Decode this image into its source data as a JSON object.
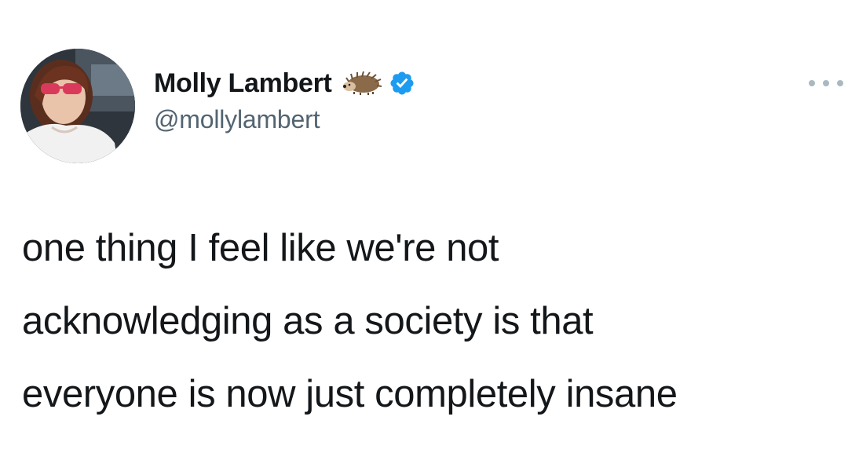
{
  "user": {
    "display_name": "Molly Lambert",
    "handle": "@mollylambert",
    "name_emoji": "hedgehog-icon",
    "verified_icon": "verified-badge-icon",
    "verified_color": "#1d9bf0"
  },
  "tweet": {
    "lines": [
      "one thing I feel like we're not",
      "acknowledging as a society is that",
      "everyone is now just completely insane"
    ]
  },
  "more_icon": "more-options-icon"
}
